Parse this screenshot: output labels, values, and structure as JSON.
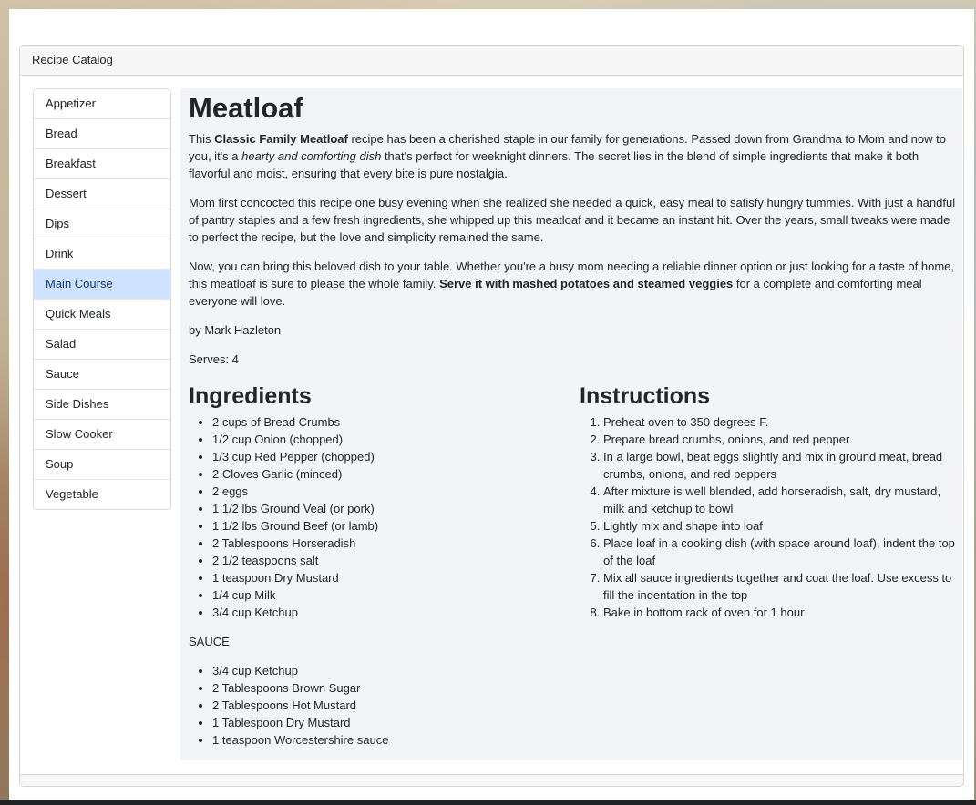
{
  "card": {
    "header": "Recipe Catalog"
  },
  "sidebar": {
    "items": [
      {
        "label": "Appetizer"
      },
      {
        "label": "Bread"
      },
      {
        "label": "Breakfast"
      },
      {
        "label": "Dessert"
      },
      {
        "label": "Dips"
      },
      {
        "label": "Drink"
      },
      {
        "label": "Main Course",
        "active": true
      },
      {
        "label": "Quick Meals"
      },
      {
        "label": "Salad"
      },
      {
        "label": "Sauce"
      },
      {
        "label": "Side Dishes"
      },
      {
        "label": "Slow Cooker"
      },
      {
        "label": "Soup"
      },
      {
        "label": "Vegetable"
      }
    ]
  },
  "recipe": {
    "title": "Meatloaf",
    "intro": {
      "p1_a": "This ",
      "p1_bold": "Classic Family Meatloaf",
      "p1_b": " recipe has been a cherished staple in our family for generations. Passed down from Grandma to Mom and now to you, it's a ",
      "p1_italic": "hearty and comforting dish",
      "p1_c": " that's perfect for weeknight dinners. The secret lies in the blend of simple ingredients that make it both flavorful and moist, ensuring that every bite is pure nostalgia.",
      "p2": "Mom first concocted this recipe one busy evening when she realized she needed a quick, easy meal to satisfy hungry tummies. With just a handful of pantry staples and a few fresh ingredients, she whipped up this meatloaf and it became an instant hit. Over the years, small tweaks were made to perfect the recipe, but the love and simplicity remained the same.",
      "p3_a": "Now, you can bring this beloved dish to your table. Whether you're a busy mom needing a reliable dinner option or just looking for a taste of home, this meatloaf is sure to please the whole family. ",
      "p3_bold": "Serve it with mashed potatoes and steamed veggies",
      "p3_b": " for a complete and comforting meal everyone will love."
    },
    "author": "by Mark Hazleton",
    "serves": "Serves: 4",
    "ingredients_heading": "Ingredients",
    "ingredients": [
      "2 cups of Bread Crumbs",
      "1/2 cup Onion (chopped)",
      "1/3 cup Red Pepper (chopped)",
      "2 Cloves Garlic (minced)",
      "2 eggs",
      "1 1/2 lbs Ground Veal (or pork)",
      "1 1/2 lbs Ground Beef (or lamb)",
      "2 Tablespoons Horseradish",
      "2 1/2 teaspoons salt",
      "1 teaspoon Dry Mustard",
      "1/4 cup Milk",
      "3/4 cup Ketchup"
    ],
    "sauce_label": "SAUCE",
    "sauce": [
      "3/4 cup Ketchup",
      "2 Tablespoons Brown Sugar",
      "2 Tablespoons Hot Mustard",
      "1 Tablespoon Dry Mustard",
      "1 teaspoon Worcestershire sauce"
    ],
    "instructions_heading": "Instructions",
    "instructions": [
      "Preheat oven to 350 degrees F.",
      "Prepare bread crumbs, onions, and red pepper.",
      "In a large bowl, beat eggs slightly and mix in ground meat, bread crumbs, onions, and red peppers",
      "After mixture is well blended, add horseradish, salt, dry mustard, milk and ketchup to bowl",
      "Lightly mix and shape into loaf",
      "Place loaf in a cooking dish (with space around loaf), indent the top of the loaf",
      "Mix all sauce ingredients together and coat the loaf. Use excess to fill the indentation in the top",
      "Bake in bottom rack of oven for 1 hour"
    ]
  }
}
